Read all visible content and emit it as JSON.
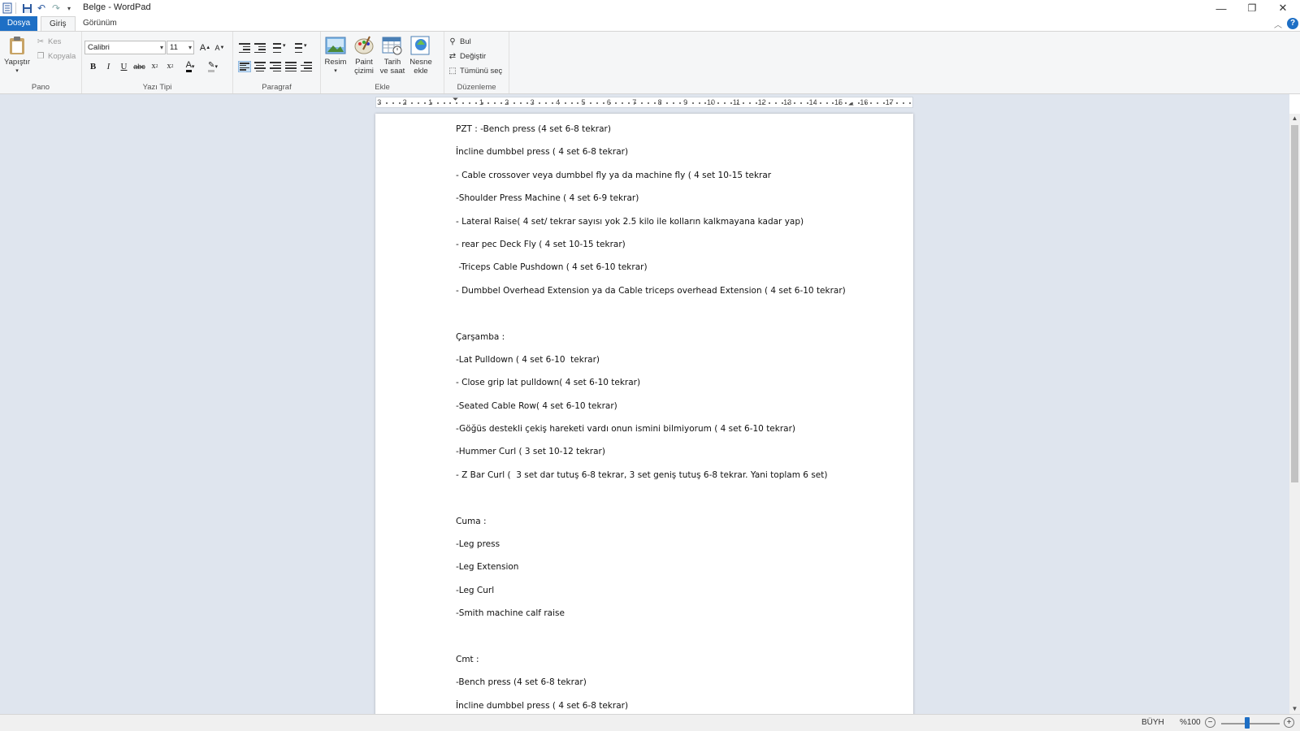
{
  "window": {
    "title": "Belge - WordPad",
    "minimize_icon": "—",
    "restore_icon": "❐",
    "close_icon": "✕"
  },
  "quick_access": [
    "app-icon",
    "save-icon",
    "undo-icon",
    "redo-icon",
    "customize-dropdown-icon"
  ],
  "tabs": {
    "file": "Dosya",
    "home": "Giriş",
    "view": "Görünüm"
  },
  "ribbon": {
    "clipboard": {
      "label": "Pano",
      "paste": "Yapıştır",
      "cut": "Kes",
      "copy": "Kopyala"
    },
    "font": {
      "label": "Yazı Tipi",
      "family": "Calibri",
      "size": "11"
    },
    "paragraph": {
      "label": "Paragraf"
    },
    "insert": {
      "label": "Ekle",
      "picture": "Resim",
      "paint_line1": "Paint",
      "paint_line2": "çizimi",
      "datetime_line1": "Tarih",
      "datetime_line2": "ve saat",
      "object_line1": "Nesne",
      "object_line2": "ekle"
    },
    "editing": {
      "label": "Düzenleme",
      "find": "Bul",
      "replace": "Değiştir",
      "select_all": "Tümünü seç"
    }
  },
  "ruler": {
    "labels": [
      "3",
      "2",
      "1",
      "1",
      "2",
      "3",
      "4",
      "5",
      "6",
      "7",
      "8",
      "9",
      "10",
      "11",
      "12",
      "13",
      "14",
      "15",
      "16",
      "17"
    ]
  },
  "document": {
    "lines": [
      "PZT : -Bench press (4 set 6-8 tekrar)",
      "İncline dumbbel press ( 4 set 6-8 tekrar)",
      "- Cable crossover veya dumbbel fly ya da machine fly ( 4 set 10-15 tekrar",
      "-Shoulder Press Machine ( 4 set 6-9 tekrar)",
      "- Lateral Raise( 4 set/ tekrar sayısı yok 2.5 kilo ile kolların kalkmayana kadar yap)",
      "- rear pec Deck Fly ( 4 set 10-15 tekrar)",
      " -Triceps Cable Pushdown ( 4 set 6-10 tekrar)",
      "- Dumbbel Overhead Extension ya da Cable triceps overhead Extension ( 4 set 6-10 tekrar)",
      "",
      "Çarşamba :",
      "-Lat Pulldown ( 4 set 6-10  tekrar)",
      "- Close grip lat pulldown( 4 set 6-10 tekrar)",
      "-Seated Cable Row( 4 set 6-10 tekrar)",
      "-Göğüs destekli çekiş hareketi vardı onun ismini bilmiyorum ( 4 set 6-10 tekrar)",
      "-Hummer Curl ( 3 set 10-12 tekrar)",
      "- Z Bar Curl (  3 set dar tutuş 6-8 tekrar, 3 set geniş tutuş 6-8 tekrar. Yani toplam 6 set)",
      "",
      "Cuma :",
      "-Leg press",
      "-Leg Extension",
      "-Leg Curl",
      "-Smith machine calf raise",
      "",
      "Cmt :",
      "-Bench press (4 set 6-8 tekrar)",
      "İncline dumbbel press ( 4 set 6-8 tekrar)"
    ]
  },
  "status": {
    "caps": "BÜYH",
    "zoom": "%100",
    "zoom_out": "−",
    "zoom_in": "+",
    "zoom_level": 1.0
  },
  "colors": {
    "accent": "#1e6fc5",
    "workspace": "#dfe5ee",
    "ribbon": "#f5f6f7"
  }
}
